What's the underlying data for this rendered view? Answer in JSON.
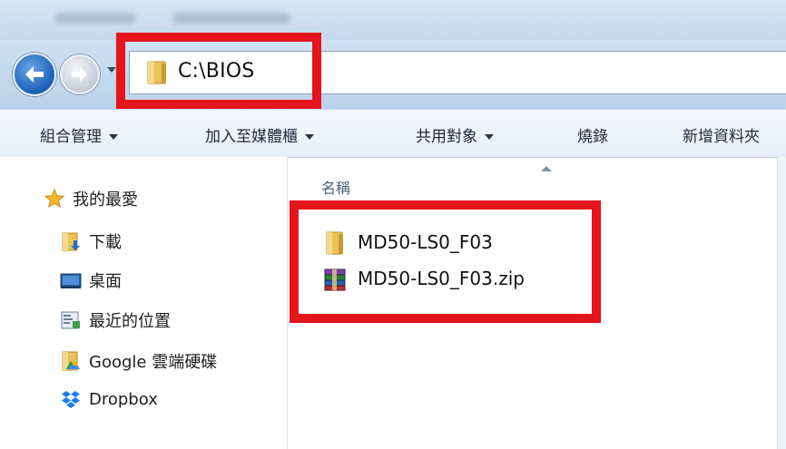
{
  "address": {
    "path": "C:\\BIOS"
  },
  "toolbar": {
    "items": [
      {
        "label": "組合管理",
        "dropdown": true
      },
      {
        "label": "加入至媒體櫃",
        "dropdown": true
      },
      {
        "label": "共用對象",
        "dropdown": true
      },
      {
        "label": "燒錄",
        "dropdown": false
      },
      {
        "label": "新增資料夾",
        "dropdown": false
      }
    ]
  },
  "nav": {
    "items": [
      {
        "label": "我的最愛",
        "icon": "star-icon"
      },
      {
        "label": "下載",
        "icon": "download-folder-icon"
      },
      {
        "label": "桌面",
        "icon": "desktop-icon"
      },
      {
        "label": "最近的位置",
        "icon": "recent-places-icon"
      },
      {
        "label": "Google 雲端硬碟",
        "icon": "google-drive-folder-icon"
      },
      {
        "label": "Dropbox",
        "icon": "dropbox-icon"
      }
    ]
  },
  "content": {
    "column_header": "名稱",
    "files": [
      {
        "name": "MD50-LS0_F03",
        "icon": "folder-icon"
      },
      {
        "name": "MD50-LS0_F03.zip",
        "icon": "winrar-archive-icon"
      }
    ]
  },
  "colors": {
    "highlight_red": "#e5141d",
    "folder_yellow": "#e9c25a",
    "back_button_blue": "#1b5fb6"
  }
}
